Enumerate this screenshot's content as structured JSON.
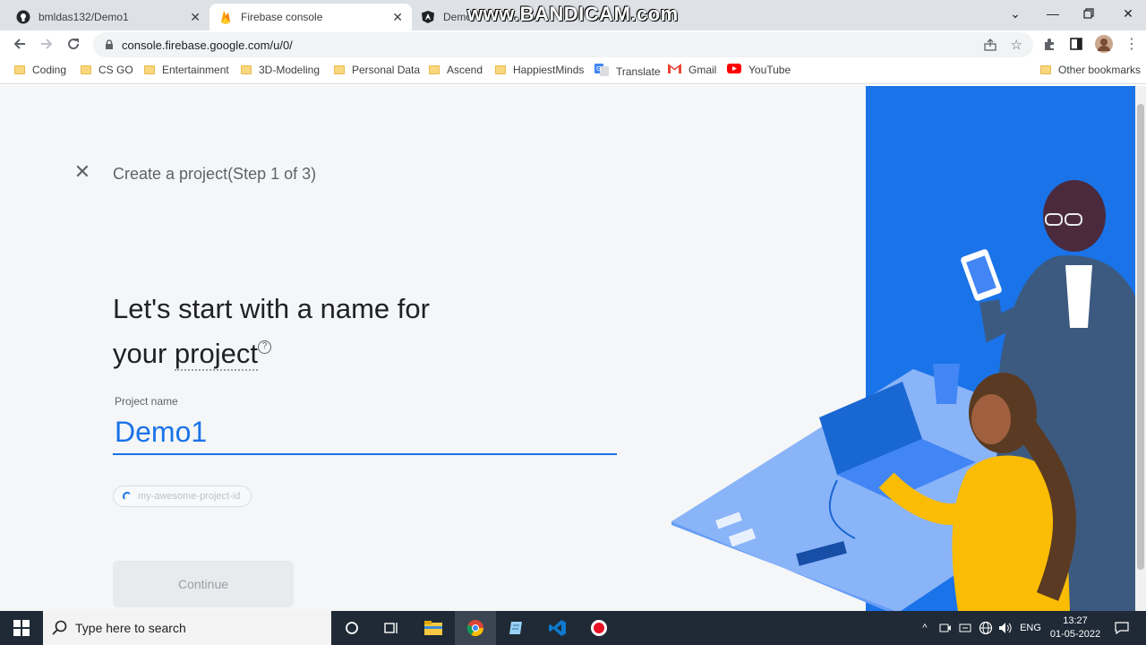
{
  "tabs": [
    {
      "title": "bmldas132/Demo1",
      "icon": "github-icon"
    },
    {
      "title": "Firebase console",
      "icon": "firebase-icon"
    },
    {
      "title": "Demo",
      "icon": "angular-icon"
    }
  ],
  "watermark": "www.BANDICAM.com",
  "address_bar": {
    "url": "console.firebase.google.com/u/0/"
  },
  "bookmarks": [
    {
      "label": "Coding",
      "icon": "folder-icon"
    },
    {
      "label": "CS GO",
      "icon": "folder-icon"
    },
    {
      "label": "Entertainment",
      "icon": "folder-icon"
    },
    {
      "label": "3D-Modeling",
      "icon": "folder-icon"
    },
    {
      "label": "Personal Data",
      "icon": "folder-icon"
    },
    {
      "label": "Ascend",
      "icon": "folder-icon"
    },
    {
      "label": "HappiestMinds",
      "icon": "folder-icon"
    },
    {
      "label": "Translate",
      "icon": "translate-icon"
    },
    {
      "label": "Gmail",
      "icon": "gmail-icon"
    },
    {
      "label": "YouTube",
      "icon": "youtube-icon"
    }
  ],
  "other_bookmarks": "Other bookmarks",
  "wizard": {
    "step_title": "Create a project(Step 1 of 3)",
    "headline_line1": "Let's start with a name for",
    "headline_line2_prefix": "your ",
    "headline_line2_link": "project",
    "help_glyph": "?",
    "field_label": "Project name",
    "field_value": "Demo1",
    "project_id_placeholder": "my-awesome-project-id",
    "continue_label": "Continue"
  },
  "taskbar": {
    "search_placeholder": "Type here to search",
    "language": "ENG",
    "time": "13:27",
    "date": "01-05-2022"
  },
  "colors": {
    "accent": "#1a73e8",
    "illustration_blue": "#1a73e8",
    "taskbar": "#1f2a36"
  }
}
